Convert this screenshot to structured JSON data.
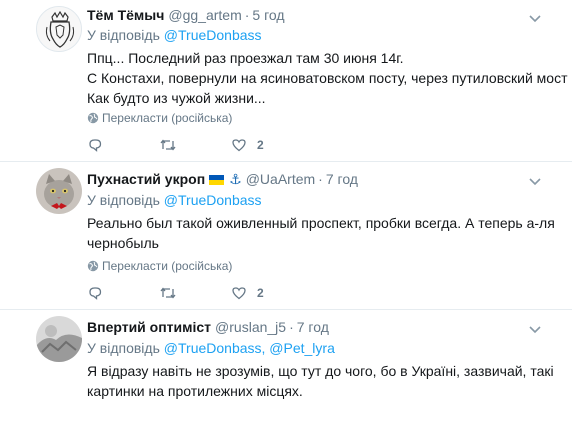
{
  "tweets": [
    {
      "name": "Тём Тёмыч",
      "handle": "@gg_artem",
      "time": "5 год",
      "reply_prefix": "У відповідь",
      "reply_to": "@TrueDonbass",
      "reply_to_2": "",
      "text_lines": [
        "Ппц... Последний раз проезжал там 30 июня 14г.",
        "С Констахи, повернули на ясиноватовском посту, через путиловский мост ...",
        "Как будто из чужой жизни..."
      ],
      "translate": "Перекласти (російська)",
      "likes": "2"
    },
    {
      "name": "Пухнастий укроп",
      "handle": "@UaArtem",
      "time": "7 год",
      "reply_prefix": "У відповідь",
      "reply_to": "@TrueDonbass",
      "reply_to_2": "",
      "text_lines": [
        "Реально был такой оживленный проспект, пробки всегда. А теперь  а-ля",
        "чернобыль"
      ],
      "translate": "Перекласти (російська)",
      "likes": "2"
    },
    {
      "name": "Впертий оптиміст",
      "handle": "@ruslan_j5",
      "time": "7 год",
      "reply_prefix": "У відповідь",
      "reply_to": "@TrueDonbass,",
      "reply_to_2": "@Pet_lyra",
      "text_lines": [
        "Я відразу навіть не зрозумів, що тут до чого, бо в Україні, зазвичай, такі",
        "картинки на протилежних місцях."
      ],
      "translate": "",
      "likes": ""
    }
  ],
  "icons": {
    "reply": "reply-icon",
    "retweet": "retweet-icon",
    "like": "heart-icon",
    "more": "chevron-down-icon",
    "globe": "globe-icon"
  },
  "colors": {
    "link": "#1da1f2",
    "muted": "#657786",
    "text": "#14171a",
    "divider": "#e6ecf0"
  }
}
